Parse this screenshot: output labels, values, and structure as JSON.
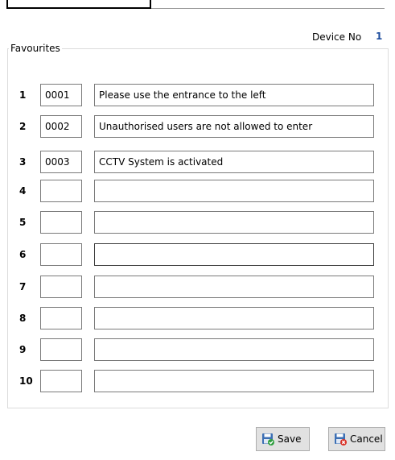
{
  "header": {
    "device_label": "Device No",
    "device_value": "1"
  },
  "favourites": {
    "legend": "Favourites",
    "rows": [
      {
        "num": "1",
        "code": "0001",
        "message": "Please use the entrance to the left"
      },
      {
        "num": "2",
        "code": "0002",
        "message": "Unauthorised users are not allowed to enter"
      },
      {
        "num": "3",
        "code": "0003",
        "message": "CCTV System is activated"
      },
      {
        "num": "4",
        "code": "",
        "message": ""
      },
      {
        "num": "5",
        "code": "",
        "message": ""
      },
      {
        "num": "6",
        "code": "",
        "message": ""
      },
      {
        "num": "7",
        "code": "",
        "message": ""
      },
      {
        "num": "8",
        "code": "",
        "message": ""
      },
      {
        "num": "9",
        "code": "",
        "message": ""
      },
      {
        "num": "10",
        "code": "",
        "message": ""
      }
    ]
  },
  "buttons": {
    "save_label": "Save",
    "cancel_label": "Cancel"
  },
  "icons": {
    "save": "save-disk-check-icon",
    "cancel": "save-disk-cancel-icon"
  },
  "colors": {
    "device_value": "#1f4e9e",
    "save_check": "#2e9e3e",
    "cancel_x": "#d93025",
    "disk": "#3c6fb4"
  }
}
